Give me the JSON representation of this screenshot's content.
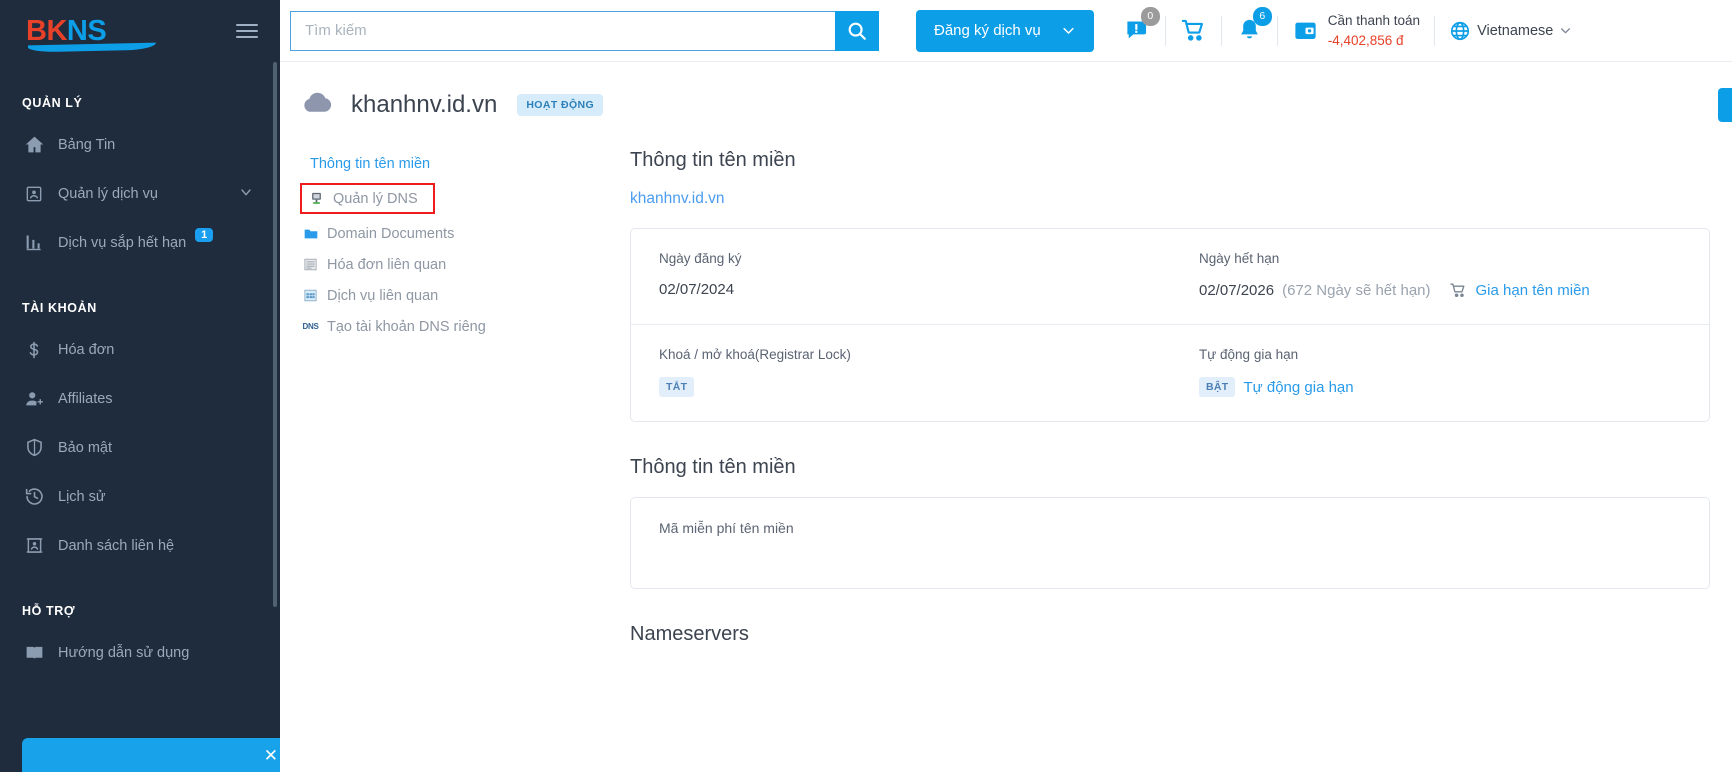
{
  "brand": {
    "name_bk": "BK",
    "name_ns": "NS"
  },
  "sidebar": {
    "sections": [
      {
        "label": "QUẢN LÝ"
      },
      {
        "label": "TÀI KHOẢN"
      },
      {
        "label": "HỖ TRỢ"
      }
    ],
    "items_manage": [
      {
        "label": "Bảng Tin",
        "icon": "home-icon"
      },
      {
        "label": "Quản lý dịch vụ",
        "icon": "card-person-icon",
        "chevron": "⌄"
      },
      {
        "label": "Dịch vụ sắp hết hạn",
        "icon": "bar-chart-icon",
        "badge": "1"
      }
    ],
    "items_account": [
      {
        "label": "Hóa đơn",
        "icon": "dollar-icon"
      },
      {
        "label": "Affiliates",
        "icon": "person-add-icon"
      },
      {
        "label": "Bảo mật",
        "icon": "shield-icon"
      },
      {
        "label": "Lịch sử",
        "icon": "history-icon"
      },
      {
        "label": "Danh sách liên hệ",
        "icon": "contact-card-icon"
      }
    ],
    "items_support": [
      {
        "label": "Hướng dẫn sử dụng",
        "icon": "book-icon"
      }
    ]
  },
  "topbar": {
    "search_placeholder": "Tìm kiếm",
    "search_value": "",
    "register_service": "Đăng ký dịch vụ",
    "ticket_count": "0",
    "notification_count": "6",
    "payment_label": "Cần thanh toán",
    "payment_amount": "-4,402,856 đ",
    "language": "Vietnamese"
  },
  "page": {
    "domain": "khanhnv.id.vn",
    "status_badge": "HOẠT ĐỘNG"
  },
  "tabs": [
    {
      "label": "Thông tin tên miền",
      "state": "active",
      "icon": ""
    },
    {
      "label": "Quản lý DNS",
      "state": "highlight",
      "icon": "server-icon"
    },
    {
      "label": "Domain Documents",
      "state": "normal",
      "icon": "folder-icon"
    },
    {
      "label": "Hóa đơn liên quan",
      "state": "normal",
      "icon": "invoice-icon"
    },
    {
      "label": "Dịch vụ liên quan",
      "state": "normal",
      "icon": "grid-icon"
    },
    {
      "label": "Tạo tài khoản DNS riêng",
      "state": "normal",
      "icon": "dns-icon"
    }
  ],
  "domain_info": {
    "section_title": "Thông tin tên miền",
    "domain_link": "khanhnv.id.vn",
    "registered_label": "Ngày đăng ký",
    "registered_value": "02/07/2024",
    "expiry_label": "Ngày hết hạn",
    "expiry_value": "02/07/2026",
    "expiry_note": "(672 Ngày sẽ hết hạn)",
    "renew_link": "Gia hạn tên miền",
    "lock_label": "Khoá / mở khoá(Registrar Lock)",
    "lock_state": "TẮT",
    "autorenew_label": "Tự động gia hạn",
    "autorenew_state": "BẬT",
    "autorenew_link": "Tự động gia hạn"
  },
  "domain_info2": {
    "section_title": "Thông tin tên miền",
    "free_code_label": "Mã miễn phí tên miền"
  },
  "nameservers": {
    "title": "Nameservers"
  },
  "colors": {
    "accent": "#0d9ee8",
    "sidebar": "#1f2c3d",
    "danger": "#ee1c1c",
    "red": "#e8412a"
  }
}
